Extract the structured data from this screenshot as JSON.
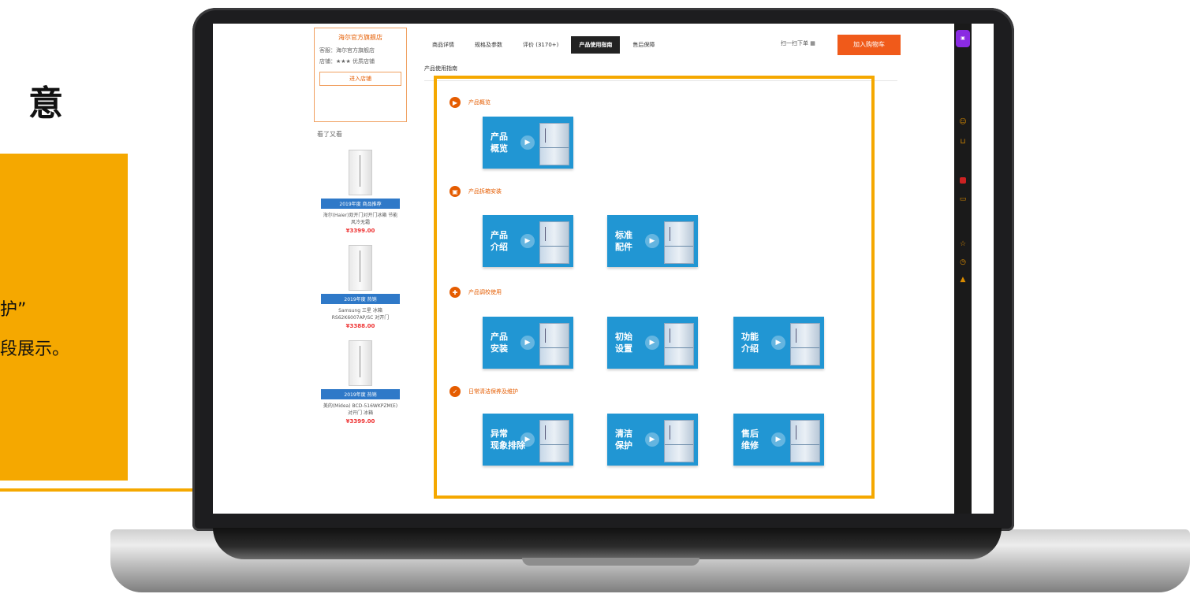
{
  "slide": {
    "title_fragment": "意",
    "callout_lines": [
      "护”",
      "段展示。"
    ],
    "accent_color": "#f5a800"
  },
  "app": {
    "tabs": [
      "商品详情",
      "规格及参数",
      "评价 (3170+)",
      "产品使用指南",
      "售后保障"
    ],
    "active_tab_index": 3,
    "qr_label": "扫一扫下单",
    "cart_label": "加入购物车",
    "section_heading": "产品使用指南",
    "brand_color": "#e55c00",
    "tile_color": "#2196d3"
  },
  "sidebar": {
    "shop_name": "海尔官方旗舰店",
    "shop_lines": [
      "客服：海尔官方旗舰店",
      "店铺：★★★ 优质店铺"
    ],
    "shop_button": "进入店铺",
    "seen_title": "看了又看",
    "products": [
      {
        "tag": "2019年度 商品推荐",
        "name": "海尔(Haier)双开门对开门冰箱 节能 风冷无霜",
        "price": "¥3399.00"
      },
      {
        "tag": "2019年度 热销",
        "name": "Samsung 三星 冰箱 RS62K6007AP/SC 对开门",
        "price": "¥3388.00"
      },
      {
        "tag": "2019年度 热销",
        "name": "美的(Midea) BCD-516WKPZM(E) 对开门 冰箱",
        "price": "¥3399.00"
      }
    ]
  },
  "sections": [
    {
      "title": "产品概览",
      "icon": "play-circle-icon",
      "tiles": [
        "产品\n概览"
      ]
    },
    {
      "title": "产品拆箱安装",
      "icon": "box-icon",
      "tiles": [
        "产品\n介绍",
        "标准\n配件"
      ]
    },
    {
      "title": "产品调校使用",
      "icon": "tool-icon",
      "tiles": [
        "产品\n安装",
        "初始\n设置",
        "功能\n介绍"
      ]
    },
    {
      "title": "日常清洁保养及维护",
      "icon": "shield-icon",
      "tiles": [
        "异常\n现象排除",
        "清洁\n保护",
        "售后\n维修"
      ]
    }
  ]
}
